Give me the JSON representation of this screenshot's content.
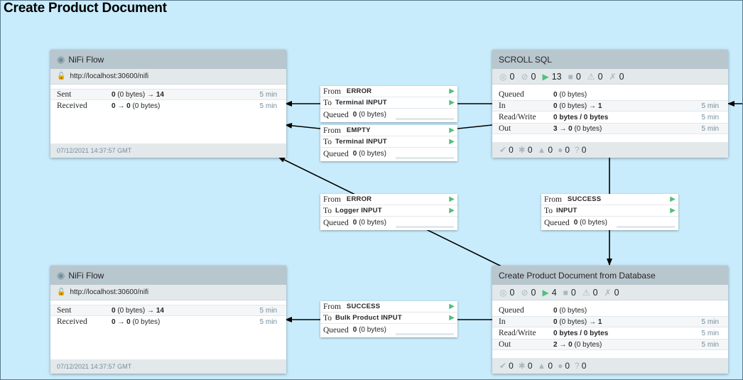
{
  "page_title": "Create Product Document",
  "remote_groups": [
    {
      "name": "NiFi Flow",
      "url": "http://localhost:30600/nifi",
      "sent_label": "Sent",
      "sent_count": "0",
      "sent_detail": " (0 bytes) → ",
      "sent_to": "14",
      "sent_time": "5 min",
      "received_label": "Received",
      "received_count": "0",
      "received_arrow": " → ",
      "received_to": "0",
      "received_detail": " (0 bytes)",
      "received_time": "5 min",
      "timestamp": "07/12/2021 14:37:57 GMT"
    },
    {
      "name": "NiFi Flow",
      "url": "http://localhost:30600/nifi",
      "sent_label": "Sent",
      "sent_count": "0",
      "sent_detail": " (0 bytes) → ",
      "sent_to": "14",
      "sent_time": "5 min",
      "received_label": "Received",
      "received_count": "0",
      "received_arrow": " → ",
      "received_to": "0",
      "received_detail": " (0 bytes)",
      "received_time": "5 min",
      "timestamp": "07/12/2021 14:37:57 GMT"
    }
  ],
  "process_groups": [
    {
      "name": "SCROLL SQL",
      "status": {
        "transmitting": "0",
        "not_transmitting": "0",
        "running": "13",
        "stopped": "0",
        "invalid": "0",
        "disabled": "0"
      },
      "queued_label": "Queued",
      "queued_value": "0",
      "queued_detail": " (0 bytes)",
      "in_label": "In",
      "in_value": "0",
      "in_detail": " (0 bytes) → ",
      "in_to": "1",
      "in_time": "5 min",
      "rw_label": "Read/Write",
      "rw_value": "0 bytes / 0 bytes",
      "rw_time": "5 min",
      "out_label": "Out",
      "out_value": "3",
      "out_arrow": " → ",
      "out_to": "0",
      "out_detail": " (0 bytes)",
      "out_time": "5 min",
      "versions": {
        "up_to_date": "0",
        "locally_modified": "0",
        "stale": "0",
        "stale_modified": "0",
        "sync_failure": "0"
      }
    },
    {
      "name": "Create Product Document from Database",
      "status": {
        "transmitting": "0",
        "not_transmitting": "0",
        "running": "4",
        "stopped": "0",
        "invalid": "0",
        "disabled": "0"
      },
      "queued_label": "Queued",
      "queued_value": "0",
      "queued_detail": " (0 bytes)",
      "in_label": "In",
      "in_value": "0",
      "in_detail": " (0 bytes) → ",
      "in_to": "1",
      "in_time": "5 min",
      "rw_label": "Read/Write",
      "rw_value": "0 bytes / 0 bytes",
      "rw_time": "5 min",
      "out_label": "Out",
      "out_value": "2",
      "out_arrow": " → ",
      "out_to": "0",
      "out_detail": " (0 bytes)",
      "out_time": "5 min",
      "versions": {
        "up_to_date": "0",
        "locally_modified": "0",
        "stale": "0",
        "stale_modified": "0",
        "sync_failure": "0"
      }
    }
  ],
  "connections": [
    {
      "from_label": "From",
      "from": "ERROR",
      "to_label": "To",
      "to": "Terminal INPUT",
      "queued_label": "Queued",
      "queued_value": "0",
      "queued_detail": " (0 bytes)"
    },
    {
      "from_label": "From",
      "from": "EMPTY",
      "to_label": "To",
      "to": "Terminal INPUT",
      "queued_label": "Queued",
      "queued_value": "0",
      "queued_detail": " (0 bytes)"
    },
    {
      "from_label": "From",
      "from": "ERROR",
      "to_label": "To",
      "to": "Logger INPUT",
      "queued_label": "Queued",
      "queued_value": "0",
      "queued_detail": " (0 bytes)"
    },
    {
      "from_label": "From",
      "from": "SUCCESS",
      "to_label": "To",
      "to": "INPUT",
      "queued_label": "Queued",
      "queued_value": "0",
      "queued_detail": " (0 bytes)"
    },
    {
      "from_label": "From",
      "from": "SUCCESS",
      "to_label": "To",
      "to": "Bulk Product INPUT",
      "queued_label": "Queued",
      "queued_value": "0",
      "queued_detail": " (0 bytes)"
    }
  ],
  "icons": {
    "remote_group": "broadcast-icon",
    "secure": "lock-icon",
    "play": "play-icon",
    "transmitting": "transmitting-icon",
    "not_transmitting": "not-transmitting-icon",
    "running": "running-icon",
    "stopped": "stopped-icon",
    "invalid": "warning-icon",
    "disabled": "disabled-icon"
  },
  "colors": {
    "canvas": "#c9ecfc",
    "header": "#b8c6cd",
    "status_bar": "#e3e8eb",
    "running": "#52bf7e",
    "muted": "#728e9b",
    "edge": "#000000"
  }
}
